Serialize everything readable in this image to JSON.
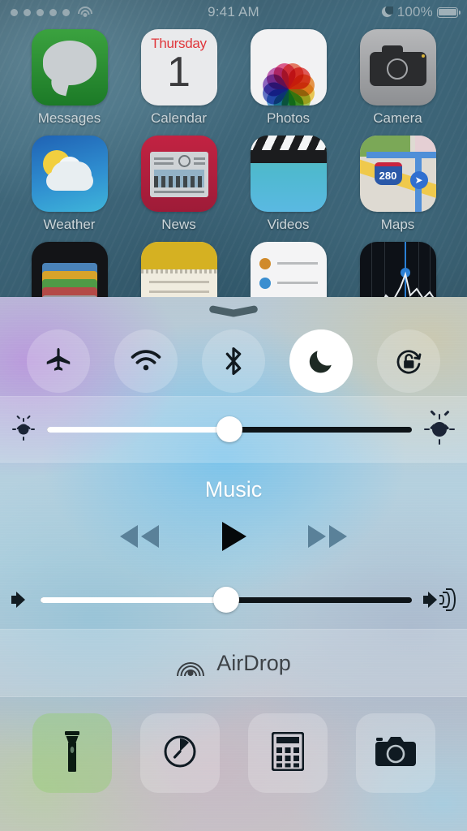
{
  "status_bar": {
    "signal_dots": 5,
    "wifi_icon": "wifi-icon",
    "time": "9:41 AM",
    "dnd_icon": "moon-icon",
    "battery_percent": "100%",
    "battery_icon": "battery-full-icon"
  },
  "home_screen": {
    "rows": [
      [
        {
          "label": "Messages",
          "icon": "messages-icon"
        },
        {
          "label": "Calendar",
          "icon": "calendar-icon",
          "weekday": "Thursday",
          "day": "1"
        },
        {
          "label": "Photos",
          "icon": "photos-icon"
        },
        {
          "label": "Camera",
          "icon": "camera-icon"
        }
      ],
      [
        {
          "label": "Weather",
          "icon": "weather-icon"
        },
        {
          "label": "News",
          "icon": "news-icon"
        },
        {
          "label": "Videos",
          "icon": "videos-icon"
        },
        {
          "label": "Maps",
          "icon": "maps-icon",
          "shield": "280"
        }
      ],
      [
        {
          "label": "",
          "icon": "wallet-icon"
        },
        {
          "label": "",
          "icon": "notes-icon"
        },
        {
          "label": "",
          "icon": "reminders-icon"
        },
        {
          "label": "",
          "icon": "stocks-icon"
        }
      ]
    ]
  },
  "control_center": {
    "grabber": "grabber-handle",
    "toggles": [
      {
        "name": "airplane-mode",
        "icon": "airplane-icon",
        "active": false
      },
      {
        "name": "wifi",
        "icon": "wifi-icon",
        "active": false
      },
      {
        "name": "bluetooth",
        "icon": "bluetooth-icon",
        "active": false
      },
      {
        "name": "do-not-disturb",
        "icon": "moon-icon",
        "active": true
      },
      {
        "name": "rotation-lock",
        "icon": "rotation-lock-icon",
        "active": false
      }
    ],
    "brightness": {
      "name": "brightness-slider",
      "value_percent": 50,
      "low_icon": "brightness-low-icon",
      "high_icon": "brightness-high-icon"
    },
    "music": {
      "title": "Music",
      "previous_icon": "rewind-icon",
      "play_icon": "play-icon",
      "next_icon": "fast-forward-icon",
      "volume": {
        "name": "volume-slider",
        "value_percent": 50,
        "low_icon": "volume-mute-icon",
        "high_icon": "volume-high-icon"
      }
    },
    "airdrop": {
      "label": "AirDrop",
      "icon": "airdrop-icon"
    },
    "shortcuts": [
      {
        "name": "flashlight",
        "icon": "flashlight-icon",
        "active": true
      },
      {
        "name": "timer",
        "icon": "timer-icon",
        "active": false
      },
      {
        "name": "calculator",
        "icon": "calculator-icon",
        "active": false
      },
      {
        "name": "camera",
        "icon": "camera-icon",
        "active": false
      }
    ]
  },
  "colors": {
    "accent_white": "#ffffff",
    "track_dark": "#0e1418",
    "icon_dark": "#121a20",
    "status_text": "#a8b8bf"
  }
}
